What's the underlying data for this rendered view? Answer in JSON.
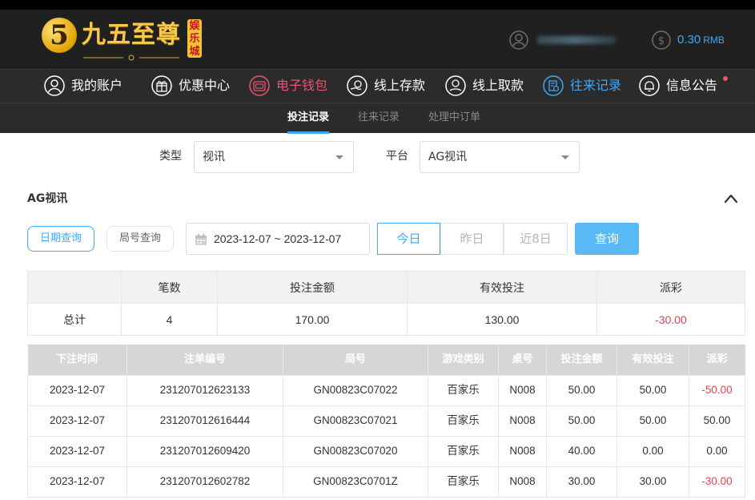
{
  "brand": {
    "logo_glyph": "5",
    "name": "九五至尊",
    "badge": "娱乐城",
    "colors": {
      "gold": "#f7c84a",
      "accent_blue": "#3fa9f5",
      "accent_pink": "#e8556f",
      "negative_red": "#e8414a"
    }
  },
  "header": {
    "user_icon": "user-circle-icon",
    "balance_icon": "dollar-coin-icon",
    "balance": "0.30",
    "currency": "RMB"
  },
  "nav": {
    "items": [
      {
        "label": "我的账户",
        "icon": "user-circle-icon",
        "state": "normal"
      },
      {
        "label": "优惠中心",
        "icon": "gift-icon",
        "state": "normal"
      },
      {
        "label": "电子钱包",
        "icon": "wallet-icon",
        "state": "highlight-pink"
      },
      {
        "label": "线上存款",
        "icon": "deposit-icon",
        "state": "normal"
      },
      {
        "label": "线上取款",
        "icon": "withdraw-icon",
        "state": "normal"
      },
      {
        "label": "往来记录",
        "icon": "record-icon",
        "state": "active"
      },
      {
        "label": "信息公告",
        "icon": "bell-icon",
        "state": "normal",
        "notification_dot": true
      }
    ]
  },
  "subnav": {
    "tabs": [
      {
        "label": "投注记录",
        "active": true
      },
      {
        "label": "往来记录",
        "active": false
      },
      {
        "label": "处理中订单",
        "active": false
      }
    ]
  },
  "filters": {
    "type_label": "类型",
    "type_value": "视讯",
    "platform_label": "平台",
    "platform_value": "AG视讯"
  },
  "section": {
    "title": "AG视讯",
    "collapse_icon": "chevron-up-icon"
  },
  "query": {
    "mode_date": "日期查询",
    "mode_round": "局号查询",
    "date_range": "2023-12-07 ~ 2023-12-07",
    "quick_today": "今日",
    "quick_yesterday": "昨日",
    "quick_8days": "近8日",
    "submit": "查询"
  },
  "summary": {
    "headers": [
      "",
      "笔数",
      "投注金额",
      "有效投注",
      "派彩"
    ],
    "row": {
      "label": "总计",
      "count": "4",
      "bet": "170.00",
      "valid": "130.00",
      "payout": "-30.00"
    }
  },
  "records": {
    "headers": [
      "下注时间",
      "注单编号",
      "局号",
      "游戏类别",
      "桌号",
      "投注金额",
      "有效投注",
      "派彩"
    ],
    "rows": [
      {
        "time": "2023-12-07",
        "order": "231207012623133",
        "round": "GN00823C07022",
        "game": "百家乐",
        "table": "N008",
        "bet": "50.00",
        "valid": "50.00",
        "payout": "-50.00",
        "negative": true
      },
      {
        "time": "2023-12-07",
        "order": "231207012616444",
        "round": "GN00823C07021",
        "game": "百家乐",
        "table": "N008",
        "bet": "50.00",
        "valid": "50.00",
        "payout": "50.00",
        "negative": false
      },
      {
        "time": "2023-12-07",
        "order": "231207012609420",
        "round": "GN00823C07020",
        "game": "百家乐",
        "table": "N008",
        "bet": "40.00",
        "valid": "0.00",
        "payout": "0.00",
        "negative": false
      },
      {
        "time": "2023-12-07",
        "order": "231207012602782",
        "round": "GN00823C0701Z",
        "game": "百家乐",
        "table": "N008",
        "bet": "30.00",
        "valid": "30.00",
        "payout": "-30.00",
        "negative": true
      }
    ]
  }
}
